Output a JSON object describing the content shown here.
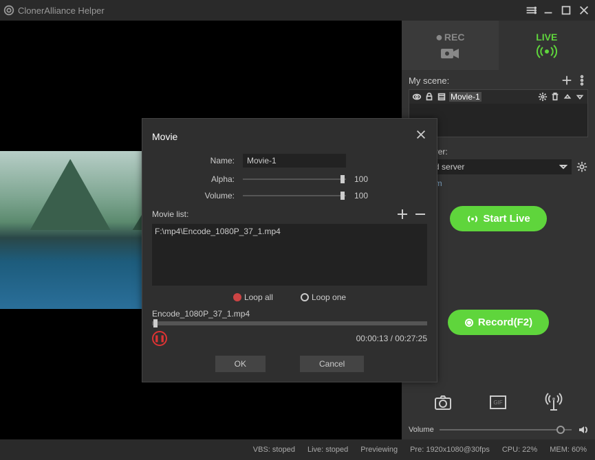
{
  "app": {
    "title": "ClonerAlliance Helper"
  },
  "titlebar": {},
  "modes": {
    "rec": "REC",
    "live": "LIVE"
  },
  "scene": {
    "label": "My scene:",
    "items": [
      "Movie-1"
    ]
  },
  "stream": {
    "label": "am server:",
    "selected": "elected server",
    "link": "live room"
  },
  "buttons": {
    "start_live": "Start Live",
    "record": "Record(F2)"
  },
  "volume": {
    "label": "Volume"
  },
  "status": {
    "vbs": "VBS: stoped",
    "live": "Live: stoped",
    "preview": "Previewing",
    "pre": "Pre: 1920x1080@30fps",
    "cpu": "CPU: 22%",
    "mem": "MEM: 60%"
  },
  "modal": {
    "title": "Movie",
    "name_label": "Name:",
    "name_value": "Movie-1",
    "alpha_label": "Alpha:",
    "alpha_value": "100",
    "volume_label": "Volume:",
    "volume_value": "100",
    "list_label": "Movie list:",
    "list_items": [
      "F:\\mp4\\Encode_1080P_37_1.mp4"
    ],
    "loop_all": "Loop all",
    "loop_one": "Loop one",
    "now_playing": "Encode_1080P_37_1.mp4",
    "time": "00:00:13 / 00:27:25",
    "ok": "OK",
    "cancel": "Cancel"
  }
}
